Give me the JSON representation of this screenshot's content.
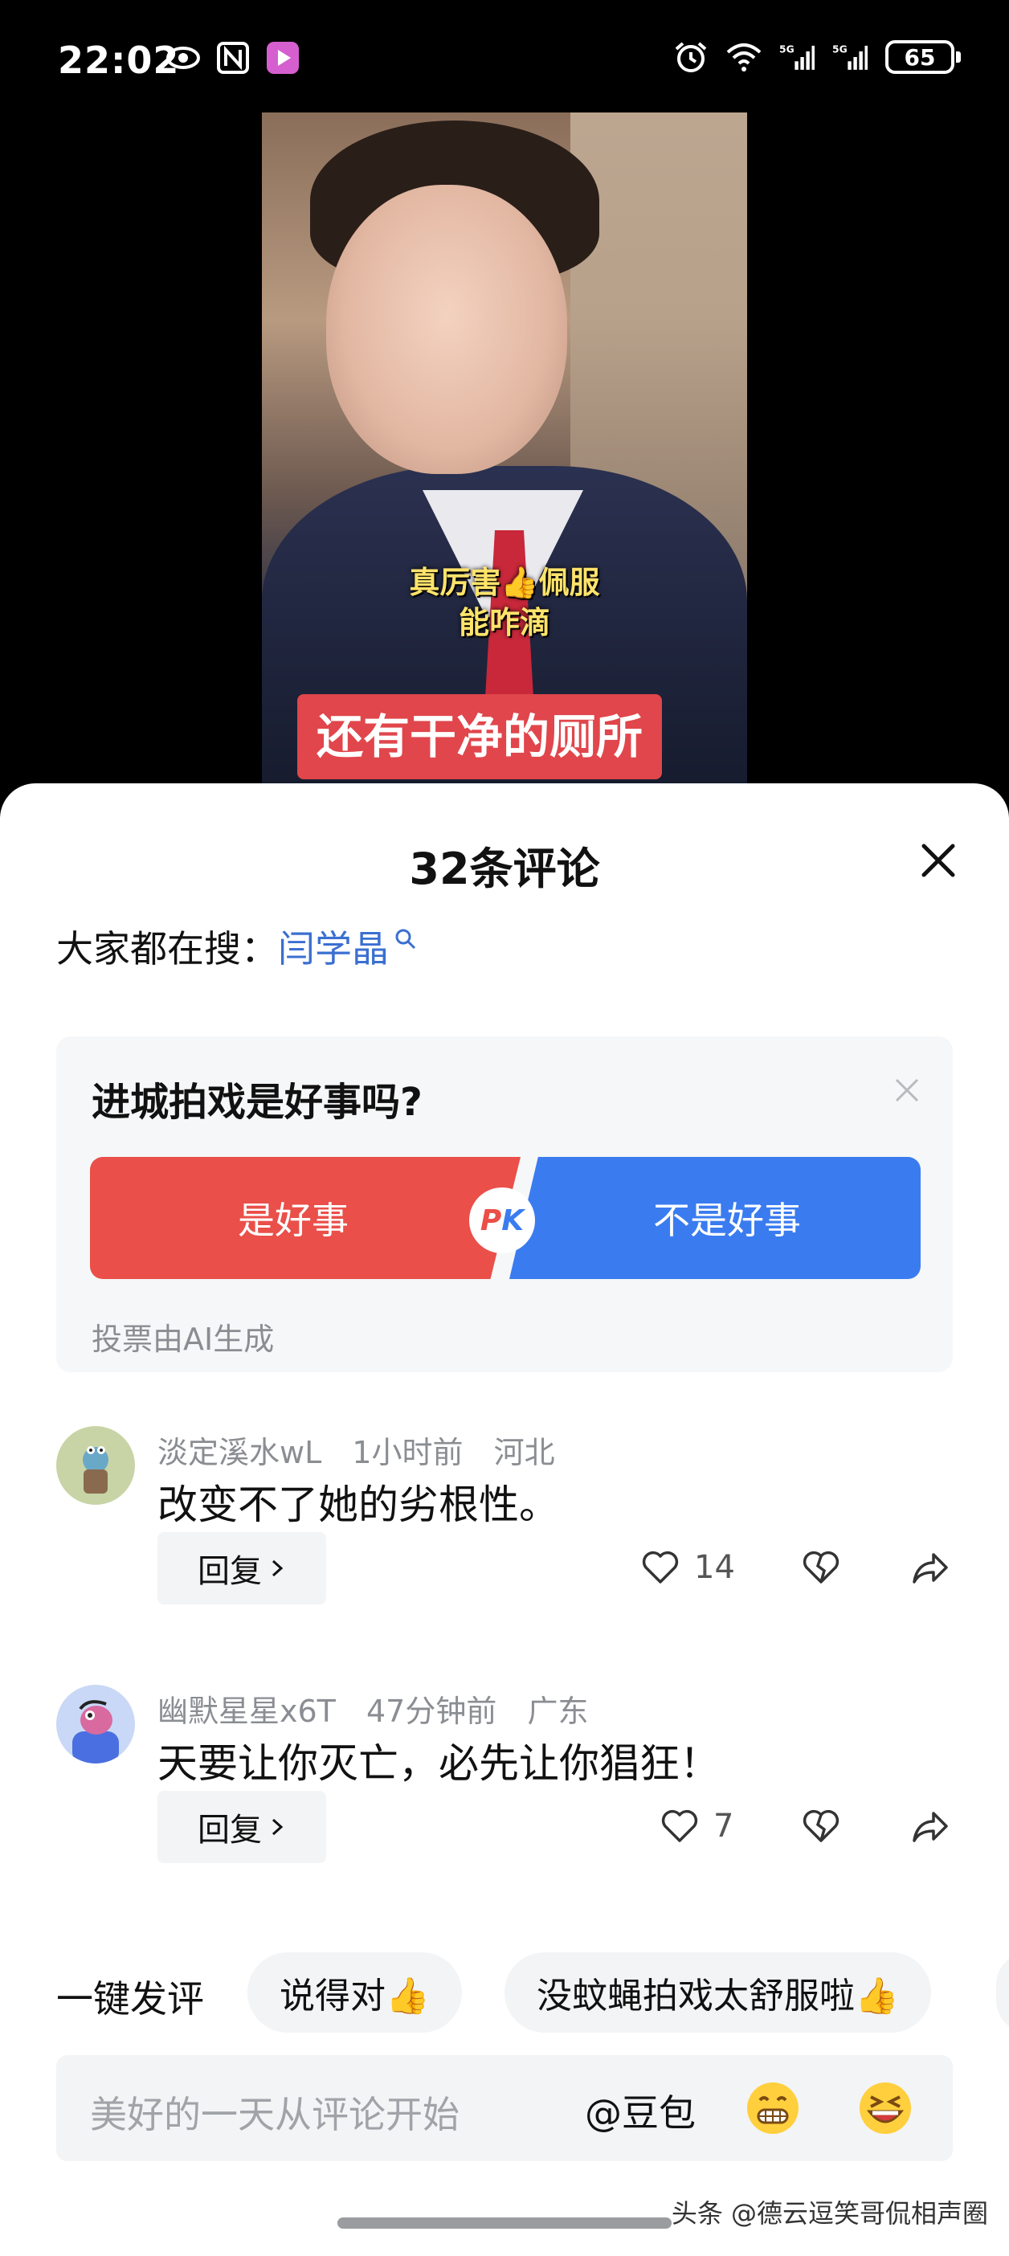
{
  "status_bar": {
    "time": "22:02",
    "battery": "65",
    "left_icons": [
      "eye-icon",
      "nfc-icon",
      "video-app-icon"
    ],
    "right_icons": [
      "alarm-icon",
      "wifi-icon",
      "signal-5g-icon",
      "signal-5g-icon"
    ]
  },
  "video": {
    "caption_top_line1": "真厉害👍佩服",
    "caption_top_line2": "能咋滴",
    "caption_bottom": "还有干净的厕所"
  },
  "sheet": {
    "title": "32条评论",
    "search_label": "大家都在搜：",
    "search_term": "闫学晶"
  },
  "poll": {
    "question": "进城拍戏是好事吗?",
    "option_yes": "是好事",
    "option_no": "不是好事",
    "pk_p": "P",
    "pk_k": "K",
    "note": "投票由AI生成",
    "colors": {
      "yes": "#ea4f49",
      "no": "#3a7cf0"
    }
  },
  "comments": [
    {
      "user": "淡定溪水wL",
      "time": "1小时前",
      "location": "河北",
      "text": "改变不了她的劣根性。",
      "reply_label": "回复",
      "likes": "14"
    },
    {
      "user": "幽默星星x6T",
      "time": "47分钟前",
      "location": "广东",
      "text": "天要让你灭亡，必先让你猖狂！",
      "reply_label": "回复",
      "likes": "7"
    }
  ],
  "quick_comment": {
    "label": "一键发评",
    "chips": [
      "说得对👍",
      "没蚊蝇拍戏太舒服啦👍"
    ]
  },
  "input": {
    "placeholder": "美好的一天从评论开始",
    "at_label": "@豆包"
  },
  "watermark": "头条 @德云逗笑哥侃相声圈"
}
